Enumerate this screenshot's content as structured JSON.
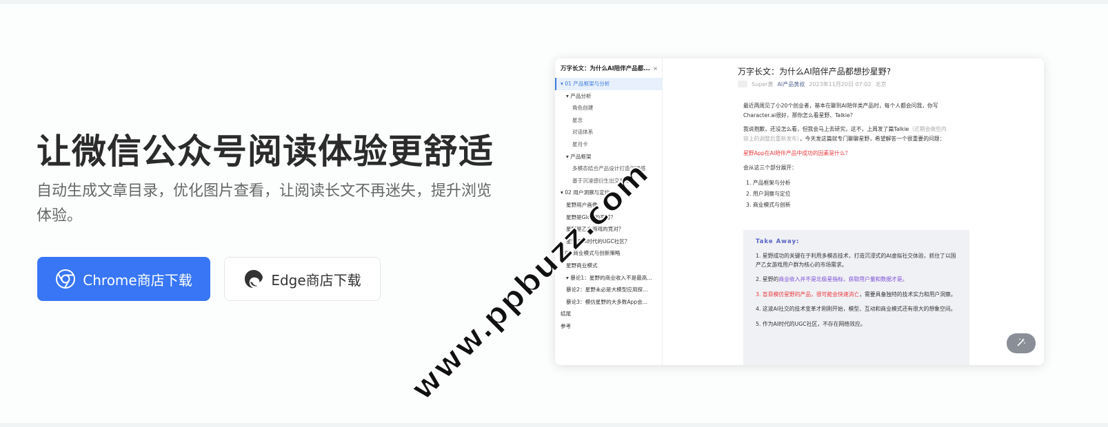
{
  "hero": {
    "title": "让微信公众号阅读体验更舒适",
    "subtitle": "自动生成文章目录，优化图片查看，让阅读长文不再迷失，提升浏览体验。",
    "chrome_button": "Chrome商店下载",
    "edge_button": "Edge商店下载"
  },
  "colors": {
    "accent": "#3876f6",
    "highlight_red": "#e8393f",
    "highlight_purple": "#7b4cd8"
  },
  "toc": {
    "header": "万字长文：为什么AI陪伴产品都...",
    "close": "×",
    "items": [
      {
        "label": "▾ 01 产品框架与分析",
        "level": 0,
        "active": true
      },
      {
        "label": "▾ 产品分析",
        "level": 1
      },
      {
        "label": "角色创建",
        "level": 2
      },
      {
        "label": "星念",
        "level": 2
      },
      {
        "label": "对话体系",
        "level": 2
      },
      {
        "label": "星月卡",
        "level": 2
      },
      {
        "label": "▾ 产品框架",
        "level": 1
      },
      {
        "label": "多模态结合产品设计打造沉浸感",
        "level": 2
      },
      {
        "label": "基于沉浸感衍生出交易体系",
        "level": 2
      },
      {
        "label": "▾ 02 用户洞察与定位",
        "level": 0
      },
      {
        "label": "星野用户画像",
        "level": 1
      },
      {
        "label": "星野是Glow的平替？",
        "level": 1
      },
      {
        "label": "星野是乙女游戏的竞对？",
        "level": 1
      },
      {
        "label": "星野是AI时代的UGC社区？",
        "level": 1
      },
      {
        "label": "▾ 03 商业模式与创新策略",
        "level": 0
      },
      {
        "label": "星野商业模式",
        "level": 1
      },
      {
        "label": "▾ 暴论1：星野的商业收入不是最高...",
        "level": 1
      },
      {
        "label": "暴论2：星野未必是大模型应用探...",
        "level": 1
      },
      {
        "label": "暴论3：模仿星野的大多数App会...",
        "level": 1
      },
      {
        "label": "结尾",
        "level": 0
      },
      {
        "label": "参考",
        "level": 0
      }
    ]
  },
  "article": {
    "title": "万字长文：为什么AI陪伴产品都想抄星野?",
    "author": "Super黄",
    "source": "AI产品黄叔",
    "date": "2023年11月20日 07:02",
    "location": "北京",
    "para1": "最近两周见了小20个创业者，基本在聊到AI陪伴类产品时，每个人都会问我，你写Character.ai很好，那你怎么看星野、Talkie？",
    "para2_a": "我说抱歉，还没怎么看，但我会马上去研究，这不，上周发了篇Talkie",
    "para2_hint": "（近期会做些内容上的调整后重新发布）",
    "para2_b": "，今天发这篇就专门聊聊星野，希望解答一个很重要的问题：",
    "question": "星野App在AI陪伴产品中成功的因素是什么？",
    "expand": "会从这三个部分展开：",
    "outline": [
      "产品框架与分析",
      "用户洞察与定位",
      "商业模式与创新"
    ],
    "takeaway_title": "Take Away:",
    "tk1": "1. 星野成功的关键在于利用多模态技术，打造沉浸式的AI虚拟社交体验，抓住了以国产乙女游戏用户群为核心的市场需求。",
    "tk2_a": "2. 星野的",
    "tk2_b": "商业收入并不是北极星指标，获取用户量和数据才是。",
    "tk3_a": "3. 盲目模仿星野的产品，很可能会快速消亡",
    "tk3_b": "，需要具备独特的技术实力和用户洞察。",
    "tk4": "4. 这波AI社交的技术变革才刚刚开始，模型、互动和商业模式还有很大的想象空间。",
    "tk5": "5. 作为AI时代的UGC社区，不存在网络效应。"
  },
  "watermark": "www.ppbuzz.com",
  "icons": {
    "chrome": "chrome-icon",
    "edge": "edge-icon",
    "magic": "magic-wand-icon"
  }
}
